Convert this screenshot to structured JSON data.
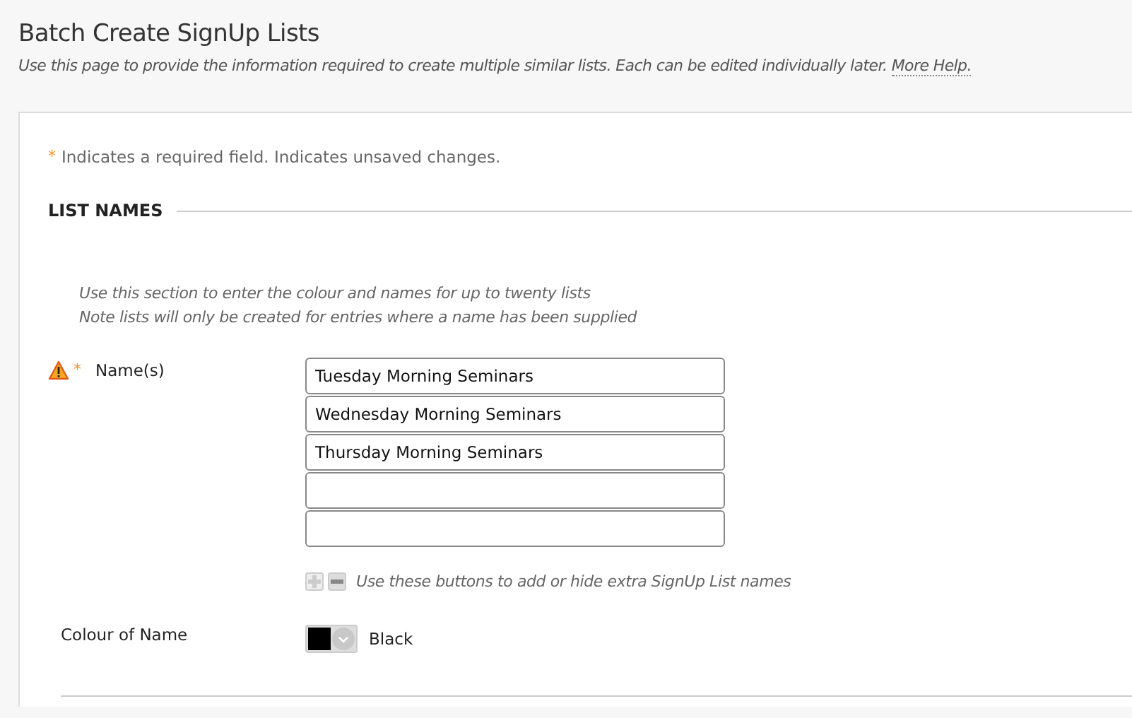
{
  "page": {
    "title": "Batch Create SignUp Lists",
    "description": "Use this page to provide the information required to create multiple similar lists. Each can be edited individually later.",
    "help_link": "More Help."
  },
  "form": {
    "required_note": {
      "mark": "*",
      "text": "Indicates a required field. Indicates unsaved changes."
    },
    "section": {
      "heading": "LIST NAMES",
      "instructions": [
        "Use this section to enter the colour and names for up to twenty lists",
        "Note lists will only be created for entries where a name has been supplied"
      ],
      "names_field": {
        "label": "Name(s)",
        "required": true,
        "warning": true,
        "inputs": [
          {
            "kind": "filled",
            "value": "Tuesday Morning Seminars"
          },
          {
            "kind": "filled",
            "value": "Wednesday Morning Seminars"
          },
          {
            "kind": "filled",
            "value": "Thursday Morning Seminars"
          },
          {
            "kind": "empty"
          },
          {
            "kind": "empty"
          }
        ],
        "buttons": [
          {
            "kind": "add",
            "disabled": true
          },
          {
            "kind": "hide",
            "disabled": false
          }
        ],
        "buttons_hint": "Use these buttons to add or hide extra SignUp List names"
      },
      "colour_field": {
        "label": "Colour of Name",
        "color": "#000000",
        "value": "Black"
      }
    }
  }
}
